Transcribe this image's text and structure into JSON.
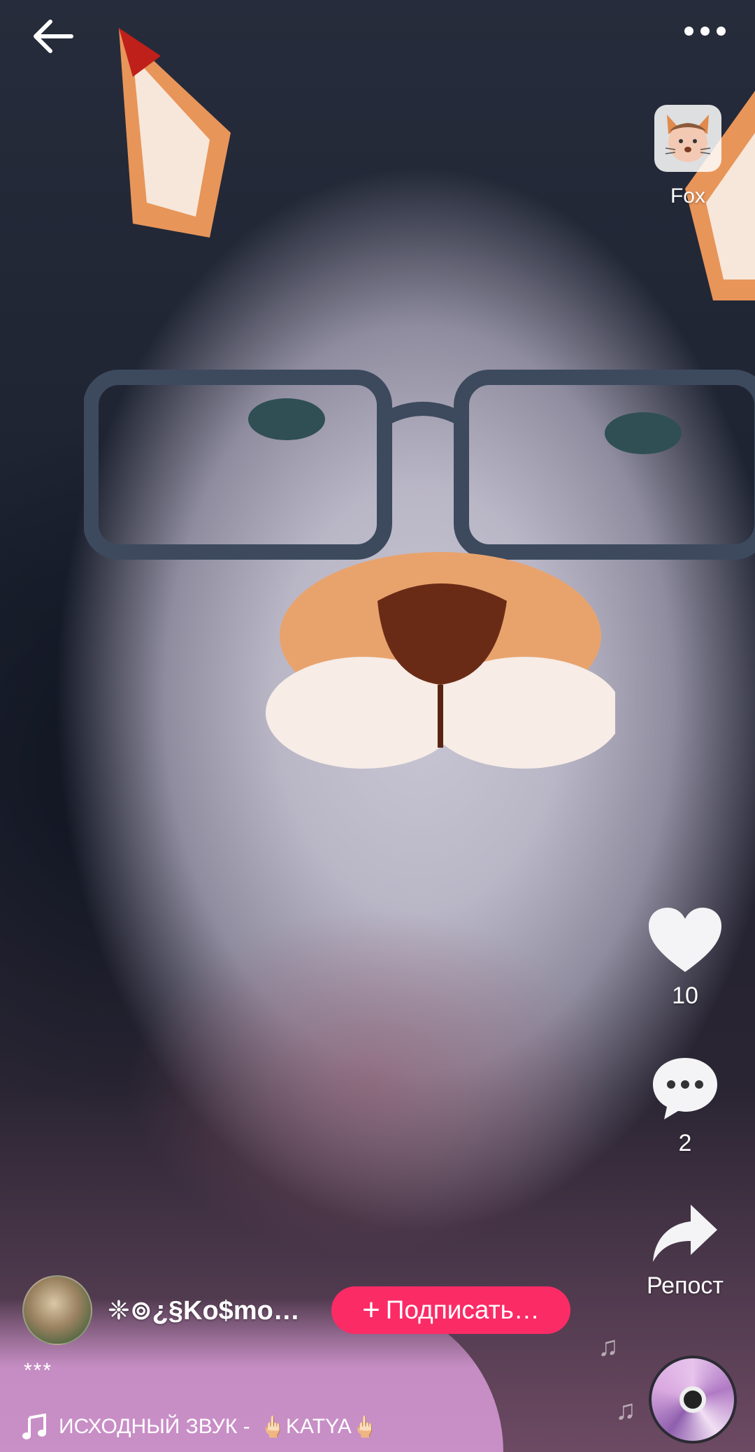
{
  "effect": {
    "label": "Fox",
    "icon": "fox-face-icon"
  },
  "actions": {
    "likes": "10",
    "comments": "2",
    "repost_label": "Репост"
  },
  "author": {
    "name": "❈⊚¿§Ko$mo…",
    "subscribe_label": "Подписать…"
  },
  "caption": "***",
  "music": {
    "prefix": "ИСХОДНЫЙ ЗВУК -",
    "artist": "KATYA",
    "hand_emoji": "🖕🏻"
  },
  "colors": {
    "accent": "#fb2b66",
    "text": "#ffffff"
  }
}
